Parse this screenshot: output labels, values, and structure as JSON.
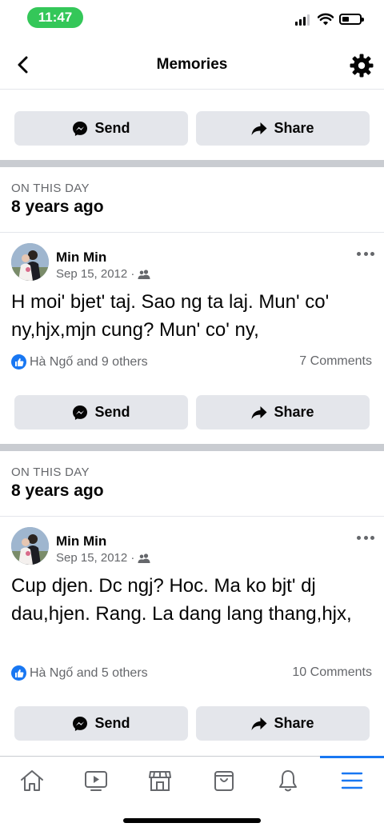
{
  "status_bar": {
    "time": "11:47"
  },
  "header": {
    "title": "Memories",
    "back_icon": "chevron-left-icon",
    "settings_icon": "gear-icon"
  },
  "top_actions": {
    "send_label": "Send",
    "share_label": "Share"
  },
  "memories": [
    {
      "on_this_day_label": "ON THIS DAY",
      "years_ago": "8 years ago",
      "author": "Min Min",
      "date": "Sep 15, 2012 ·",
      "text": "H moi' bjet' taj. Sao ng ta laj. Mun' co' ny,hjx,mjn cung? Mun' co' ny,",
      "reactions": "Hà Ngố and 9 others",
      "comments": "7 Comments",
      "send_label": "Send",
      "share_label": "Share"
    },
    {
      "on_this_day_label": "ON THIS DAY",
      "years_ago": "8 years ago",
      "author": "Min Min",
      "date": "Sep 15, 2012 ·",
      "text": "Cup djen. Dc ngj? Hoc. Ma ko bjt' dj dau,hjen. Rang. La dang lang thang,hjx,",
      "reactions": "Hà Ngố and 5 others",
      "comments": "10 Comments",
      "send_label": "Send",
      "share_label": "Share"
    }
  ],
  "tab_bar": {
    "tabs": [
      "home-icon",
      "video-icon",
      "marketplace-icon",
      "shopping-bag-icon",
      "bell-icon",
      "menu-icon"
    ],
    "active": "menu-icon"
  },
  "colors": {
    "accent": "#1877f2",
    "button_bg": "#e4e6eb",
    "secondary_text": "#65676b",
    "status_pill": "#34c759"
  }
}
